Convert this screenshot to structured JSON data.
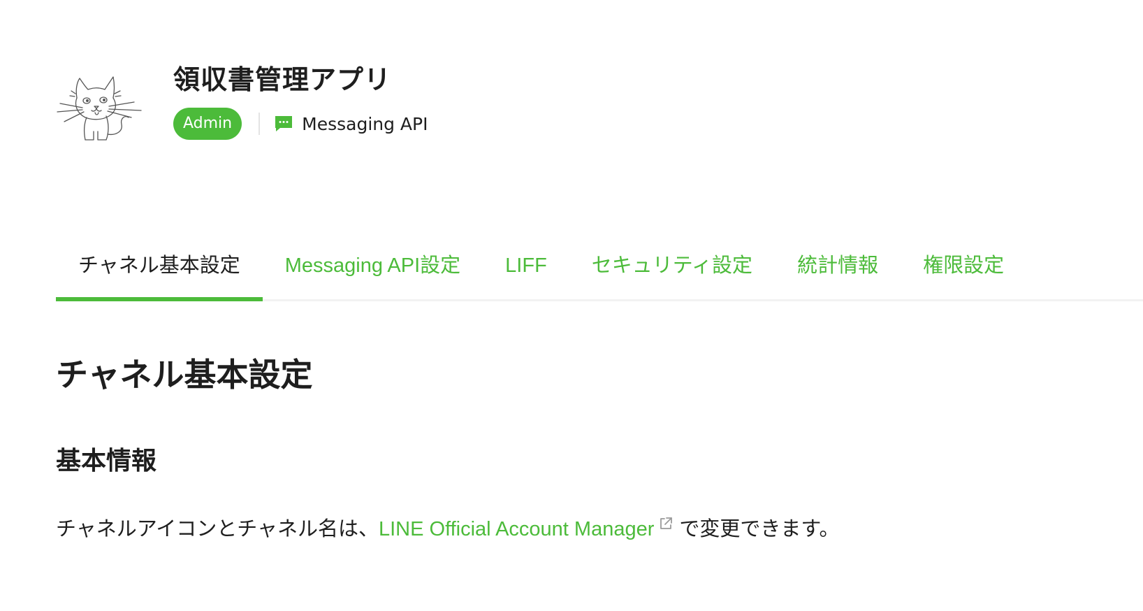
{
  "channel": {
    "name": "領収書管理アプリ",
    "role_badge": "Admin",
    "type_label": "Messaging API",
    "icon": "cat-sketch-avatar",
    "type_icon": "chat-bubble-icon"
  },
  "tabs": [
    {
      "label": "チャネル基本設定",
      "active": true
    },
    {
      "label": "Messaging API設定",
      "active": false
    },
    {
      "label": "LIFF",
      "active": false
    },
    {
      "label": "セキュリティ設定",
      "active": false
    },
    {
      "label": "統計情報",
      "active": false
    },
    {
      "label": "権限設定",
      "active": false
    }
  ],
  "content": {
    "section_title": "チャネル基本設定",
    "subsection_title": "基本情報",
    "info_prefix": "チャネルアイコンとチャネル名は、",
    "info_link": "LINE Official Account Manager",
    "info_suffix": "で変更できます。",
    "link_icon": "external-link-icon"
  },
  "colors": {
    "accent": "#4cbb3a",
    "text": "#1e1e1e",
    "divider": "#f2f2f2"
  }
}
